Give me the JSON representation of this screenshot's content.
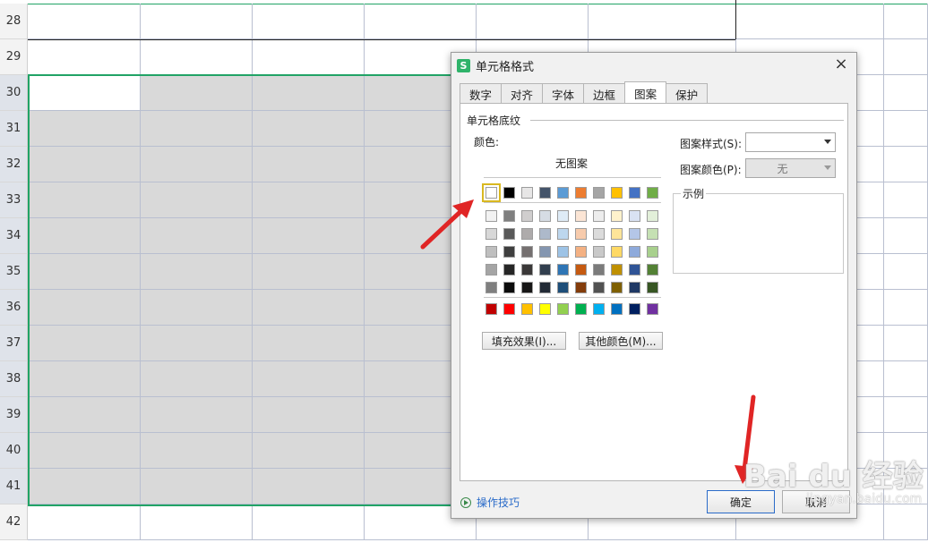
{
  "sheet": {
    "rows": [
      "28",
      "29",
      "30",
      "31",
      "32",
      "33",
      "34",
      "35",
      "36",
      "37",
      "38",
      "39",
      "40",
      "41",
      "42"
    ]
  },
  "dialog": {
    "title": "单元格格式",
    "close_glyph": "×",
    "tabs": [
      "数字",
      "对齐",
      "字体",
      "边框",
      "图案",
      "保护"
    ],
    "active_tab": "图案",
    "group_title": "单元格底纹",
    "color_label": "颜色:",
    "no_pattern": "无图案",
    "fill_effects_button": "填充效果(I)...",
    "more_colors_button": "其他颜色(M)...",
    "pattern_style_label": "图案样式(S):",
    "pattern_style_value": "",
    "pattern_color_label": "图案颜色(P):",
    "pattern_color_value": "无",
    "sample_label": "示例",
    "tips_link": "操作技巧",
    "ok_button": "确定",
    "cancel_button": "取消",
    "palette": {
      "theme_top": [
        "#ffffff",
        "#000000",
        "#e7e6e6",
        "#44546a",
        "#5b9bd5",
        "#ed7d31",
        "#a5a5a5",
        "#ffc000",
        "#4472c4",
        "#70ad47"
      ],
      "tints": [
        [
          "#f2f2f2",
          "#7f7f7f",
          "#d0cece",
          "#d6dce4",
          "#deebf6",
          "#fbe5d5",
          "#ededed",
          "#fff2cc",
          "#d9e2f3",
          "#e2efd9"
        ],
        [
          "#d8d8d8",
          "#595959",
          "#aeabab",
          "#adb9ca",
          "#bdd7ee",
          "#f7cbac",
          "#dbdbdb",
          "#fee599",
          "#b4c6e7",
          "#c5e0b3"
        ],
        [
          "#bfbfbf",
          "#3f3f3f",
          "#757070",
          "#8496b0",
          "#9dc3e6",
          "#f4b183",
          "#c9c9c9",
          "#ffd965",
          "#8eaadb",
          "#a8d08d"
        ],
        [
          "#a5a5a5",
          "#262626",
          "#3a3838",
          "#323f4f",
          "#2e75b5",
          "#c55a11",
          "#7b7b7b",
          "#bf9000",
          "#2f5496",
          "#538135"
        ],
        [
          "#7f7f7f",
          "#0c0c0c",
          "#171616",
          "#222a35",
          "#1e4e79",
          "#833c0b",
          "#525252",
          "#7f6000",
          "#1f3864",
          "#375623"
        ]
      ],
      "standard": [
        "#c00000",
        "#ff0000",
        "#ffc000",
        "#ffff00",
        "#92d050",
        "#00b050",
        "#00b0f0",
        "#0070c0",
        "#002060",
        "#7030a0"
      ]
    }
  },
  "watermark": {
    "text": "Bai du 经验",
    "sub": "jingyan.baidu.com"
  }
}
